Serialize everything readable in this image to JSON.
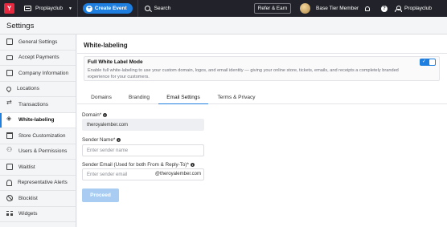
{
  "topbar": {
    "logo_letter": "Y",
    "org_name": "Proplayclub",
    "create_label": "Create Event",
    "search_label": "Search",
    "refer_label": "Refer & Earn",
    "tier_label": "Base Tier Member",
    "user_name": "Proplayclub"
  },
  "page": {
    "title": "Settings"
  },
  "sidebar": {
    "items": [
      {
        "label": "General Settings",
        "icon": "settings-square-icon"
      },
      {
        "label": "Accept Payments",
        "icon": "card-icon"
      },
      {
        "label": "Company Information",
        "icon": "document-icon"
      },
      {
        "label": "Locations",
        "icon": "pin-icon"
      },
      {
        "label": "Transactions",
        "icon": "arrows-icon"
      },
      {
        "label": "White-labeling",
        "icon": "tag-icon",
        "active": true
      },
      {
        "label": "Store Customization",
        "icon": "store-icon"
      },
      {
        "label": "Users & Permissions",
        "icon": "users-icon"
      },
      {
        "label": "Waitlist",
        "icon": "list-icon"
      },
      {
        "label": "Representative Alerts",
        "icon": "bell-icon"
      },
      {
        "label": "Blocklist",
        "icon": "block-icon"
      },
      {
        "label": "Widgets",
        "icon": "grid-icon"
      }
    ]
  },
  "main": {
    "section_title": "White-labeling",
    "card": {
      "title": "Full White Label Mode",
      "description": "Enable full white-labeling to use your custom domain, logos, and email identity — giving your online store, tickets, emails, and receipts a completely branded experience for your customers.",
      "toggle_on": true
    },
    "tabs": [
      {
        "label": "Domains"
      },
      {
        "label": "Branding"
      },
      {
        "label": "Email Settings",
        "active": true
      },
      {
        "label": "Terms & Privacy"
      }
    ],
    "form": {
      "domain_label": "Domain*",
      "domain_value": "theroyalember.com",
      "sender_name_label": "Sender Name*",
      "sender_name_placeholder": "Enter sender name",
      "sender_email_label": "Sender Email (Used for both From & Reply-To)*",
      "sender_email_placeholder": "Enter sender email",
      "sender_email_suffix": "@theroyalember.com",
      "proceed_label": "Proceed"
    }
  },
  "colors": {
    "accent": "#1f7fe0",
    "topbar": "#22232a",
    "brand_logo": "#e8283f",
    "proceed_disabled": "#a9cdf2"
  }
}
